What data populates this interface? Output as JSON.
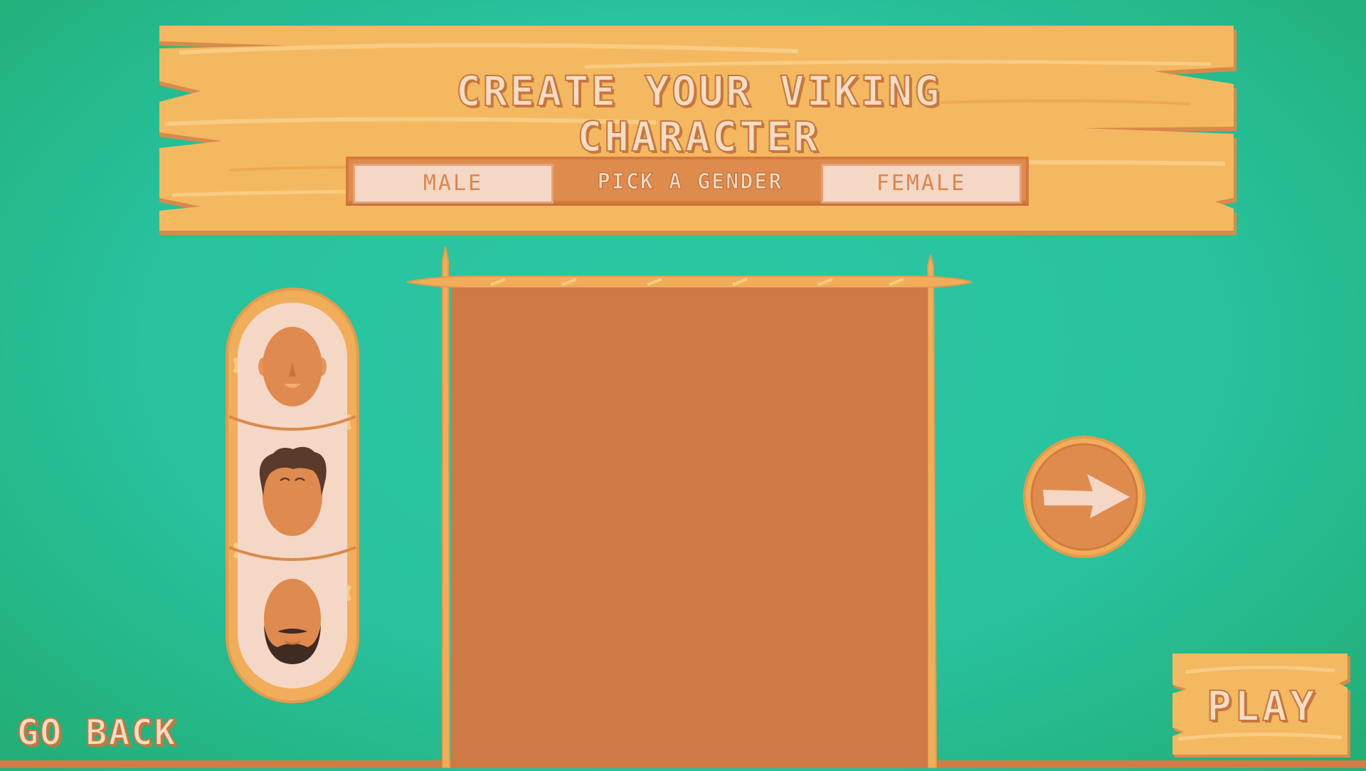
{
  "title": {
    "line1": "CREATE YOUR VIKING",
    "line2": "CHARACTER"
  },
  "gender_selector": {
    "male_label": "MALE",
    "prompt": "PICK A GENDER",
    "female_label": "FEMALE"
  },
  "face_options": [
    {
      "icon": "bald-face-icon"
    },
    {
      "icon": "curly-hair-face-icon"
    },
    {
      "icon": "bearded-face-icon"
    }
  ],
  "navigation": {
    "go_back_label": "GO BACK",
    "play_label": "PLAY",
    "next_icon": "right-arrow-icon"
  },
  "colors": {
    "background": "#28c29e",
    "wood": "#f4b860",
    "wood_dark": "#d98a4a",
    "panel": "#cd7a45",
    "cream": "#f5d7c5"
  }
}
